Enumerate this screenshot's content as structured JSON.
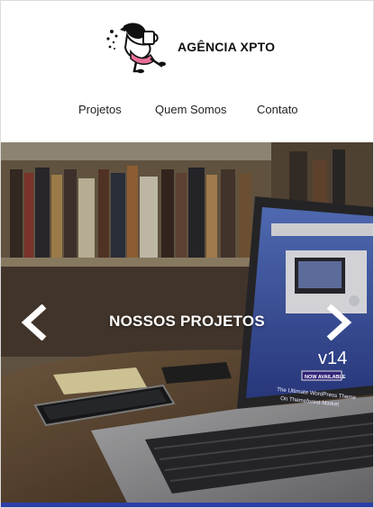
{
  "brand": {
    "name": "AGÊNCIA XPTO",
    "logo_icon": "character-logo-icon"
  },
  "nav": {
    "items": [
      {
        "label": "Projetos"
      },
      {
        "label": "Quem Somos"
      },
      {
        "label": "Contato"
      }
    ]
  },
  "hero": {
    "title": "NOSSOS PROJETOS",
    "prev_icon": "chevron-left-icon",
    "next_icon": "chevron-right-icon",
    "screen_badge": "NOW AVAILABLE",
    "screen_version": "v14",
    "screen_caption_1": "The Ultimate WordPress Theme",
    "screen_caption_2": "On Themeforest Market"
  },
  "colors": {
    "accent_bar": "#2c3ea8",
    "header_bg": "#ffffff",
    "text": "#222222"
  }
}
